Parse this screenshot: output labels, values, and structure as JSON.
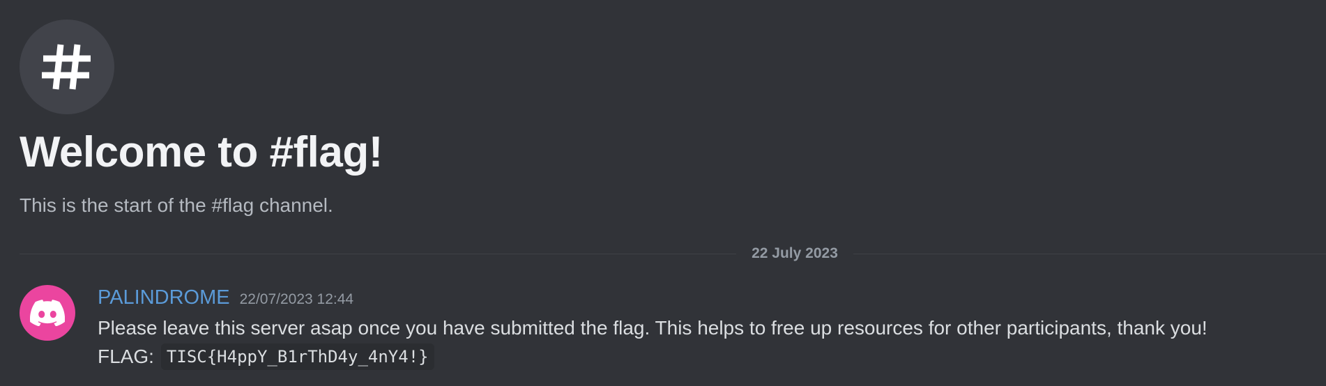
{
  "channel": {
    "icon": "hash-icon",
    "welcome_title": "Welcome to #flag!",
    "welcome_subtitle": "This is the start of the #flag channel."
  },
  "divider": {
    "date": "22 July 2023"
  },
  "message": {
    "avatar_icon": "discord-logo-icon",
    "avatar_color": "#eb459f",
    "author": "PALINDROME",
    "author_color": "#5b9bd9",
    "timestamp": "22/07/2023 12:44",
    "text": "Please leave this server asap once you have submitted the flag. This helps to free up resources for other participants, thank you!",
    "flag_label": "FLAG:",
    "flag_code": "TISC{H4ppY_B1rThD4y_4nY4!}"
  },
  "colors": {
    "background": "#313338",
    "icon_circle": "#41434a",
    "code_background": "#2b2d31"
  }
}
